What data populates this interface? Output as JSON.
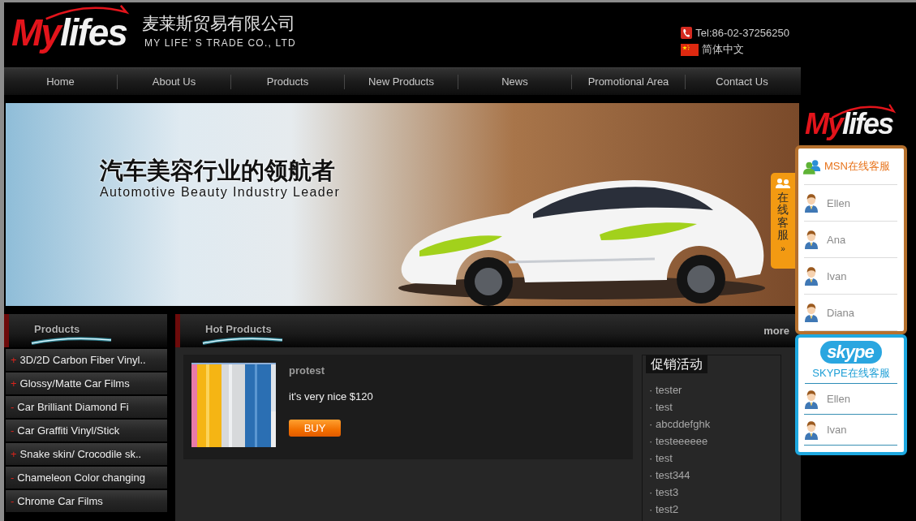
{
  "header": {
    "logo": {
      "accent": "My",
      "rest": "lifes"
    },
    "company_name": "麦莱斯贸易有限公司",
    "company_name_en": "MY LIFE’ S TRADE CO., LTD",
    "phone": "Tel:86-02-37256250",
    "language": "简体中文"
  },
  "nav": [
    "Home",
    "About Us",
    "Products",
    "New Products",
    "News",
    "Promotional Area",
    "Contact Us"
  ],
  "banner": {
    "headline": "汽车美容行业的领航者",
    "subtitle": "Automotive Beauty Industry Leader"
  },
  "sidebar": {
    "title": "Products",
    "items": [
      {
        "marker": "+",
        "label": "3D/2D Carbon Fiber Vinyl.."
      },
      {
        "marker": "+",
        "label": "Glossy/Matte Car Films"
      },
      {
        "marker": "-",
        "label": "Car Brilliant Diamond Fi"
      },
      {
        "marker": "-",
        "label": "Car Graffiti Vinyl/Stick"
      },
      {
        "marker": "+",
        "label": "Snake skin/ Crocodile sk.."
      },
      {
        "marker": "-",
        "label": "Chameleon Color changing"
      },
      {
        "marker": "-",
        "label": "Chrome Car Films"
      }
    ]
  },
  "hot_products": {
    "title": "Hot Products",
    "more": "more",
    "products": [
      {
        "name": "protest",
        "description": "it's very nice $120",
        "button": "BUY"
      }
    ]
  },
  "promotions": {
    "title": "促销活动",
    "items": [
      "· tester",
      "· test",
      "· abcddefghk",
      "· testeeeeee",
      "· test",
      "· test344",
      "· test3",
      "· test2"
    ]
  },
  "online_service": {
    "tab": {
      "label": "在线客服",
      "arrow": "»"
    },
    "logo": {
      "accent": "My",
      "rest": "lifes"
    },
    "msn": {
      "title": "MSN在线客服",
      "agents": [
        "Ellen",
        "Ana",
        "Ivan",
        "Diana"
      ]
    },
    "skype": {
      "logo": "skype",
      "title": "SKYPE在线客服",
      "agents": [
        "Ellen",
        "Ivan"
      ]
    }
  }
}
